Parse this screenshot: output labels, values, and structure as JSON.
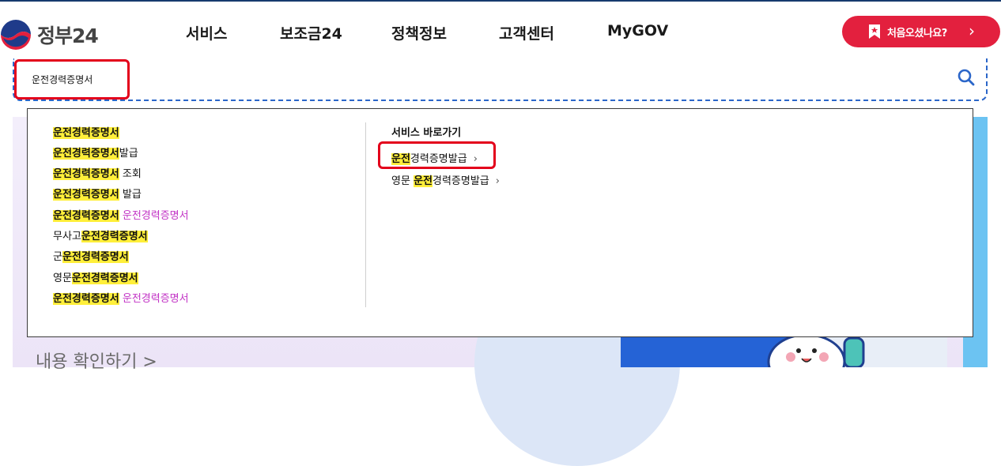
{
  "header": {
    "logo_text": "정부24",
    "nav": [
      "서비스",
      "보조금24",
      "정책정보",
      "고객센터",
      "MyGOV"
    ],
    "first_visit_label": "처음오셨나요?",
    "first_visit_chevron": "›"
  },
  "search": {
    "value": "운전경력증명서",
    "icon": "search-icon"
  },
  "suggestions": [
    {
      "parts": [
        {
          "text": "운전경력증명서",
          "style": "mark"
        }
      ]
    },
    {
      "parts": [
        {
          "text": "운전경력증명서",
          "style": "mark"
        },
        {
          "text": "발급",
          "style": "plain"
        }
      ]
    },
    {
      "parts": [
        {
          "text": "운전경력증명서",
          "style": "mark"
        },
        {
          "text": " 조회",
          "style": "plain"
        }
      ]
    },
    {
      "parts": [
        {
          "text": "운전경력증명서",
          "style": "mark"
        },
        {
          "text": " 발급",
          "style": "plain"
        }
      ]
    },
    {
      "parts": [
        {
          "text": "운전경력증명서",
          "style": "mark"
        },
        {
          "text": " 운전경력증명서",
          "style": "pink"
        }
      ]
    },
    {
      "parts": [
        {
          "text": "무사고",
          "style": "plain"
        },
        {
          "text": "운전경력증명서",
          "style": "mark"
        }
      ]
    },
    {
      "parts": [
        {
          "text": "군",
          "style": "plain"
        },
        {
          "text": "운전경력증명서",
          "style": "mark"
        }
      ]
    },
    {
      "parts": [
        {
          "text": "영문",
          "style": "plain"
        },
        {
          "text": "운전경력증명서",
          "style": "mark"
        }
      ]
    },
    {
      "parts": [
        {
          "text": "운전경력증명서",
          "style": "mark"
        },
        {
          "text": " 운전경력증명서",
          "style": "pink"
        }
      ]
    }
  ],
  "service_shortcuts": {
    "title": "서비스 바로가기",
    "items": [
      {
        "parts": [
          {
            "text": "운전",
            "style": "mark"
          },
          {
            "text": "경력증명발급",
            "style": "plain"
          }
        ],
        "arrow": "›"
      },
      {
        "parts": [
          {
            "text": "영문 ",
            "style": "plain"
          },
          {
            "text": "운전",
            "style": "mark"
          },
          {
            "text": "경력증명발급",
            "style": "plain"
          }
        ],
        "arrow": "›"
      }
    ]
  },
  "banner": {
    "link_text": "내용 확인하기 >"
  },
  "colors": {
    "accent_red": "#e3203e",
    "highlight_yellow": "#ffef3a",
    "pink_text": "#c233c5",
    "search_border": "#2b66c9"
  }
}
